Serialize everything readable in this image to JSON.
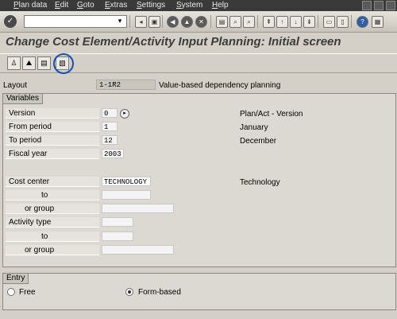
{
  "menu": [
    "Plan data",
    "Edit",
    "Goto",
    "Extras",
    "Settings",
    "System",
    "Help"
  ],
  "title": "Change Cost Element/Activity Input Planning: Initial screen",
  "layout": {
    "label": "Layout",
    "value": "1-1R2",
    "description": "Value-based dependency planning"
  },
  "variables": {
    "group_title": "Variables",
    "version": {
      "label": "Version",
      "value": "0",
      "description": "Plan/Act - Version"
    },
    "from_period": {
      "label": "From period",
      "value": "1",
      "description": "January"
    },
    "to_period": {
      "label": "To period",
      "value": "12",
      "description": "December"
    },
    "fiscal_year": {
      "label": "Fiscal year",
      "value": "2003"
    },
    "cost_center": {
      "label": "Cost center",
      "value": "TECHNOLOGY",
      "description": "Technology"
    },
    "cost_center_to": {
      "label": "to",
      "value": ""
    },
    "cost_center_group": {
      "label": "or group",
      "value": ""
    },
    "activity_type": {
      "label": "Activity type",
      "value": ""
    },
    "activity_type_to": {
      "label": "to",
      "value": ""
    },
    "activity_type_group": {
      "label": "or group",
      "value": ""
    }
  },
  "entry": {
    "group_title": "Entry",
    "options": [
      {
        "label": "Free",
        "selected": false
      },
      {
        "label": "Form-based",
        "selected": true
      }
    ]
  },
  "colors": {
    "highlight": "#1a4fb3",
    "menubar": "#3a3a3a"
  }
}
